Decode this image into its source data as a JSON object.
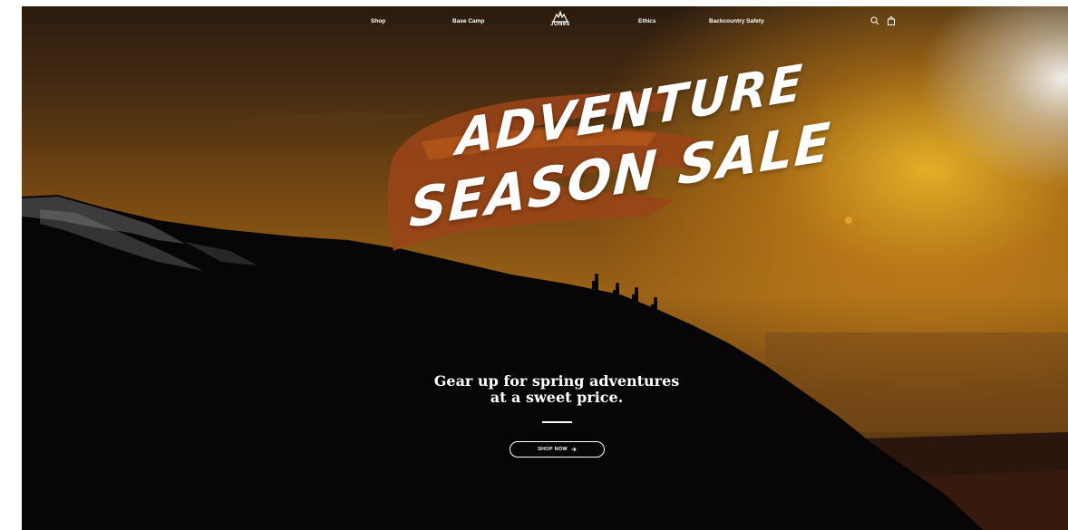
{
  "nav": {
    "left_items": [
      "Shop",
      "Base Camp"
    ],
    "right_items": [
      "Ethics",
      "Backcountry Safety"
    ],
    "logo_text": "JONeS",
    "icons": {
      "search": "search-icon",
      "cart": "shopping-bag-icon"
    }
  },
  "hero": {
    "headline_line1": "ADVENTURE",
    "headline_line2": "SEASON SALE",
    "tagline_line1": "Gear up for spring adventures",
    "tagline_line2": "at a sweet price.",
    "cta_label": "SHOP NOW",
    "cta_icon": "arrow-right-icon"
  },
  "colors": {
    "sky_gold": "#e0a11e",
    "brush_rust": "#a5491c",
    "silhouette": "#070505",
    "text": "#ffffff"
  }
}
